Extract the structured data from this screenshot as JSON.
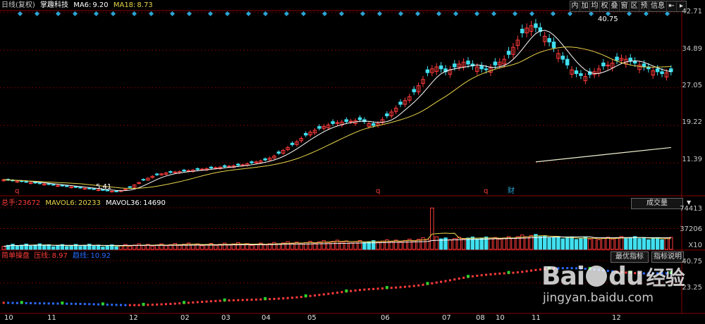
{
  "header": {
    "period": "日线(复权)",
    "stock": "掌趣科技",
    "ma6_label": "MA6:",
    "ma6_value": "9.20",
    "ma18_label": "MA18:",
    "ma18_value": "8.73"
  },
  "toolbar": {
    "items": [
      "内",
      "加",
      "均",
      "权",
      "叠",
      "窗",
      "区",
      "预",
      "信息"
    ],
    "arrow": "⇤",
    "more": "▸"
  },
  "price_axis": [
    "42.71",
    "34.89",
    "27.05",
    "19.22",
    "11.39"
  ],
  "high_label": "40.75",
  "low_label": "5.41",
  "events": {
    "q1": "q",
    "q2": "q",
    "q3": "q",
    "cai": "财"
  },
  "volume": {
    "total_label": "总手:",
    "total_value": "23672",
    "mavol6_label": "MAVOL6:",
    "mavol6_value": "20233",
    "mavol36_label": "MAVOL36:",
    "mavol36_value": "14690",
    "selector": "成交量",
    "selector_arrow": "▼",
    "axis": [
      "74413",
      "37206",
      "X10"
    ]
  },
  "indicator": {
    "name": "简单操盘",
    "trend_label": "压线:",
    "trend_value": "8.97",
    "support_label": "趋线:",
    "support_value": "10.92",
    "best_button": "最优指标",
    "help_button": "指标说明",
    "axis": [
      "40.75",
      "23.25"
    ]
  },
  "months": [
    "10",
    "11",
    "12",
    "02",
    "03",
    "04",
    "05",
    "06",
    "07",
    "08",
    "10",
    "11",
    "12"
  ],
  "watermark": {
    "brand_a": "Bai",
    "brand_b": "du",
    "brand_c": "经验",
    "url": "jingyan.baidu.com"
  },
  "colors": {
    "bg": "#000000",
    "up": "#ff3b3b",
    "down": "#40e0f0",
    "ma6": "#ffffff",
    "ma18": "#e8d44a",
    "grid": "#6e0000",
    "marker": "#2aa4d4"
  },
  "chart_data": {
    "type": "candlestick",
    "price_range": [
      5.41,
      42.71
    ],
    "price_ticks": [
      42.71,
      34.89,
      27.05,
      19.22,
      11.39
    ],
    "low": 5.41,
    "high": 40.75,
    "closes": [
      7.9,
      7.8,
      7.7,
      7.6,
      7.5,
      7.4,
      7.3,
      7.2,
      7.1,
      7.0,
      6.9,
      6.8,
      6.7,
      6.6,
      6.5,
      6.4,
      6.3,
      6.2,
      6.1,
      6.0,
      5.9,
      5.8,
      5.7,
      5.6,
      5.5,
      5.41,
      5.6,
      5.9,
      6.3,
      6.8,
      7.3,
      7.8,
      8.2,
      8.6,
      8.9,
      9.1,
      9.3,
      9.4,
      9.5,
      9.6,
      9.7,
      9.8,
      9.9,
      10.0,
      10.1,
      10.2,
      10.3,
      10.4,
      10.5,
      10.6,
      10.7,
      10.8,
      10.9,
      11.0,
      11.2,
      11.4,
      11.6,
      11.8,
      12.0,
      12.4,
      12.8,
      13.4,
      14.0,
      14.6,
      15.2,
      15.8,
      16.5,
      17.2,
      17.8,
      18.2,
      18.6,
      19.0,
      19.3,
      19.6,
      19.8,
      19.9,
      20.0,
      20.1,
      20.2,
      20.4,
      20.0,
      19.6,
      19.2,
      19.6,
      20.4,
      21.2,
      22.0,
      22.8,
      23.6,
      24.4,
      25.2,
      26.2,
      27.5,
      28.8,
      30.2,
      31.0,
      31.4,
      31.0,
      30.4,
      30.8,
      31.4,
      32.0,
      32.4,
      32.0,
      31.6,
      31.4,
      31.0,
      30.8,
      31.2,
      31.8,
      32.4,
      33.0,
      34.0,
      35.5,
      37.0,
      38.5,
      39.5,
      40.0,
      39.6,
      38.8,
      37.8,
      36.6,
      35.4,
      34.2,
      33.0,
      31.8,
      30.8,
      30.0,
      29.6,
      29.4,
      29.8,
      30.4,
      31.0,
      31.6,
      31.8,
      32.2,
      32.8,
      33.2,
      33.0,
      32.6,
      32.2,
      31.8,
      31.4,
      31.0,
      30.6,
      30.4,
      30.0,
      30.2,
      30.4
    ],
    "volume_range": [
      0,
      74413
    ],
    "volume_ticks": [
      74413,
      37206
    ],
    "mavol6": 20233,
    "mavol36": 14690,
    "indicator_range": [
      0,
      40.75
    ],
    "indicator_ticks": [
      40.75,
      23.25
    ],
    "months": [
      "10",
      "11",
      "12",
      "02",
      "03",
      "04",
      "05",
      "06",
      "07",
      "08",
      "10",
      "11",
      "12"
    ]
  }
}
